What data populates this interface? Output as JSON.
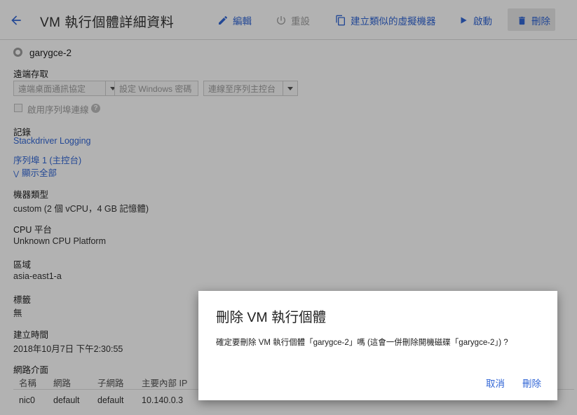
{
  "header": {
    "title": "VM 執行個體詳細資料",
    "toolbar": {
      "edit": "編輯",
      "reset": "重設",
      "create_similar": "建立類似的虛擬機器",
      "start": "啟動",
      "delete": "刪除"
    }
  },
  "instance": {
    "name": "garygce-2"
  },
  "remote_access": {
    "label": "遠端存取",
    "rdp_button": "遠端桌面通訊協定",
    "set_windows_password": "設定 Windows 密碼",
    "serial_console_button": "連線至序列主控台",
    "enable_serial_checkbox_label": "啟用序列埠連線"
  },
  "logs": {
    "label": "記錄",
    "stackdriver_link": "Stackdriver Logging",
    "serial_port_link": "序列埠 1 (主控台)",
    "show_all_link": "顯示全部"
  },
  "machine_type": {
    "label": "機器類型",
    "value": "custom (2 個 vCPU，4 GB 記憶體)"
  },
  "cpu_platform": {
    "label": "CPU 平台",
    "value": "Unknown CPU Platform"
  },
  "zone": {
    "label": "區域",
    "value": "asia-east1-a"
  },
  "labels": {
    "label": "標籤",
    "value": "無"
  },
  "created": {
    "label": "建立時間",
    "value": "2018年10月7日 下午2:30:55"
  },
  "network_interfaces": {
    "label": "網路介面",
    "columns": [
      "名稱",
      "網路",
      "子網路",
      "主要內部 IP"
    ],
    "rows": [
      {
        "name": "nic0",
        "network": "default",
        "subnet": "default",
        "internal_ip": "10.140.0.3"
      }
    ]
  },
  "dialog": {
    "title": "刪除 VM 執行個體",
    "message": "確定要刪除 VM 執行個體「garygce-2」嗎 (這會一併刪除開機磁碟「garygce-2」) ?",
    "cancel": "取消",
    "confirm": "刪除"
  },
  "colors": {
    "accent": "#3367d6",
    "overlay": "rgba(0,0,0,0.30)"
  }
}
